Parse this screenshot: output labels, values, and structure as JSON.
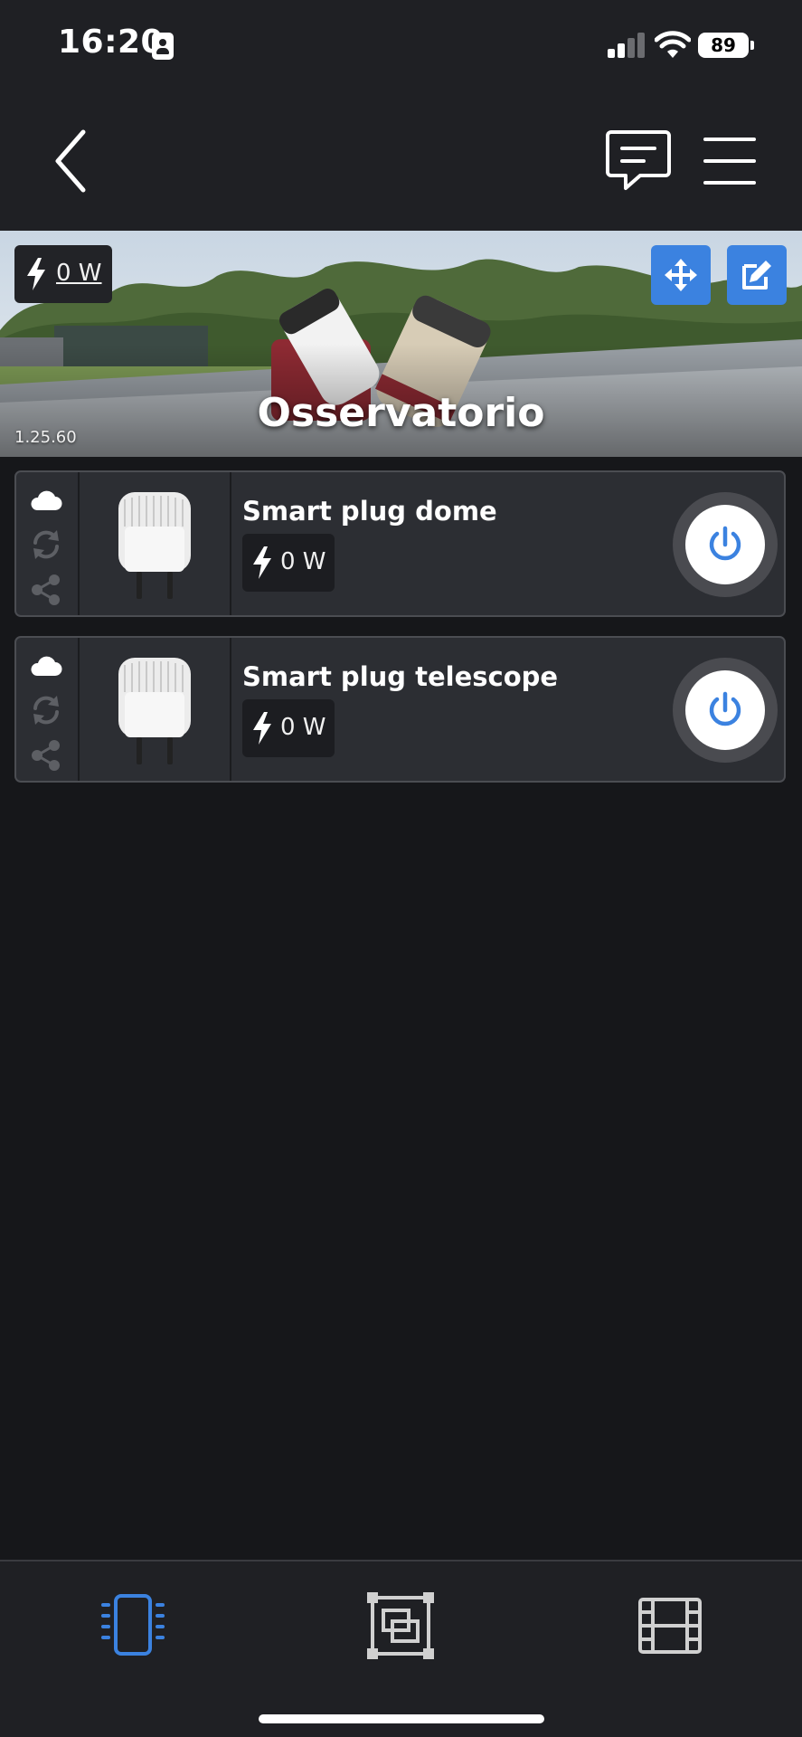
{
  "status_bar": {
    "time": "16:20",
    "battery": "89",
    "icons": [
      "contact-card-icon",
      "cellular-signal-icon",
      "wifi-icon",
      "battery-icon"
    ]
  },
  "header": {
    "icons": [
      "chevron-left-icon",
      "chat-icon",
      "hamburger-menu-icon"
    ]
  },
  "room": {
    "title": "Osservatorio",
    "total_power": "0 W",
    "version": "1.25.60",
    "icons": [
      "bolt-icon",
      "move-arrows-icon",
      "edit-icon"
    ]
  },
  "devices": [
    {
      "name": "Smart plug dome",
      "power": "0 W"
    },
    {
      "name": "Smart plug telescope",
      "power": "0 W"
    }
  ],
  "card_icons": [
    "cloud-icon",
    "sync-icon",
    "share-icon",
    "bolt-icon",
    "power-icon"
  ],
  "bottom_nav": {
    "items": [
      "devices-icon",
      "rooms-icon",
      "scenes-icon"
    ],
    "active": "devices-icon"
  },
  "colors": {
    "accent": "#3b82e0",
    "background": "#16171a",
    "bar": "#1f2024",
    "card": "#2c2e33"
  }
}
